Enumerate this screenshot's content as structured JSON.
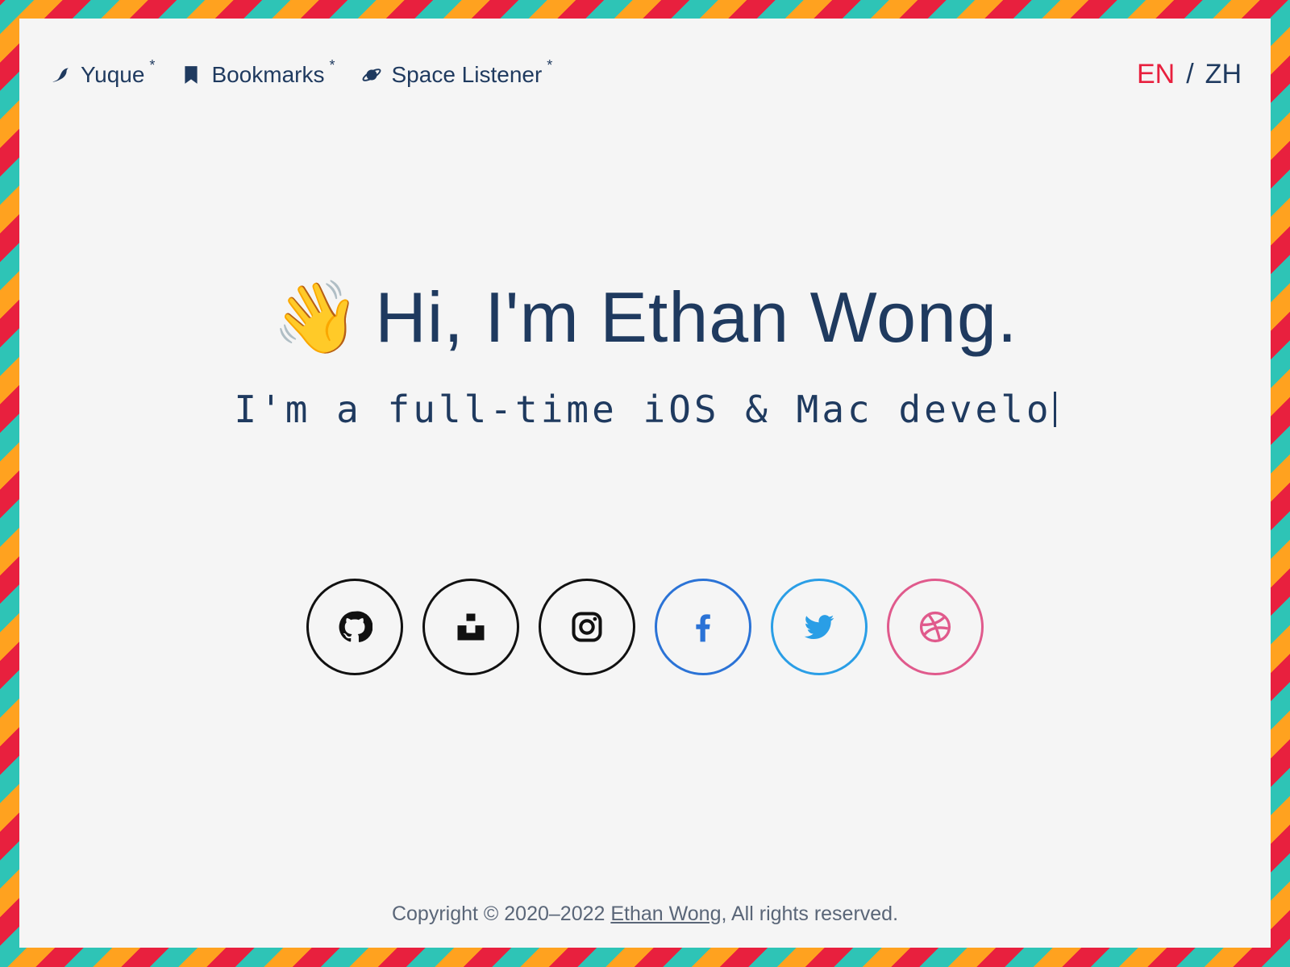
{
  "nav": {
    "links": [
      {
        "label": "Yuque",
        "mark": "*",
        "icon": "bird-icon"
      },
      {
        "label": "Bookmarks",
        "mark": "*",
        "icon": "bookmark-icon"
      },
      {
        "label": "Space Listener",
        "mark": "*",
        "icon": "planet-icon"
      }
    ]
  },
  "lang": {
    "en": "EN",
    "sep": "/",
    "zh": "ZH",
    "active": "EN"
  },
  "hero": {
    "emoji": "👋",
    "title": "Hi, I'm Ethan Wong.",
    "subtitle": "I'm a full-time iOS & Mac develo"
  },
  "socials": [
    {
      "name": "GitHub",
      "icon": "github-icon",
      "color": "#111111"
    },
    {
      "name": "Unsplash",
      "icon": "unsplash-icon",
      "color": "#111111"
    },
    {
      "name": "Instagram",
      "icon": "instagram-icon",
      "color": "#111111"
    },
    {
      "name": "Facebook",
      "icon": "facebook-icon",
      "color": "#2b73d6"
    },
    {
      "name": "Twitter",
      "icon": "twitter-icon",
      "color": "#2a9ee6"
    },
    {
      "name": "Dribbble",
      "icon": "dribbble-icon",
      "color": "#e05a8c"
    }
  ],
  "footer": {
    "prefix": "Copyright © 2020–2022 ",
    "author": "Ethan Wong",
    "suffix": ", All rights reserved."
  },
  "colors": {
    "accent": "#e8203e",
    "text": "#1f3a5f",
    "stripe_teal": "#2ec4b6",
    "stripe_red": "#e8203e",
    "stripe_orange": "#ffa21f"
  }
}
